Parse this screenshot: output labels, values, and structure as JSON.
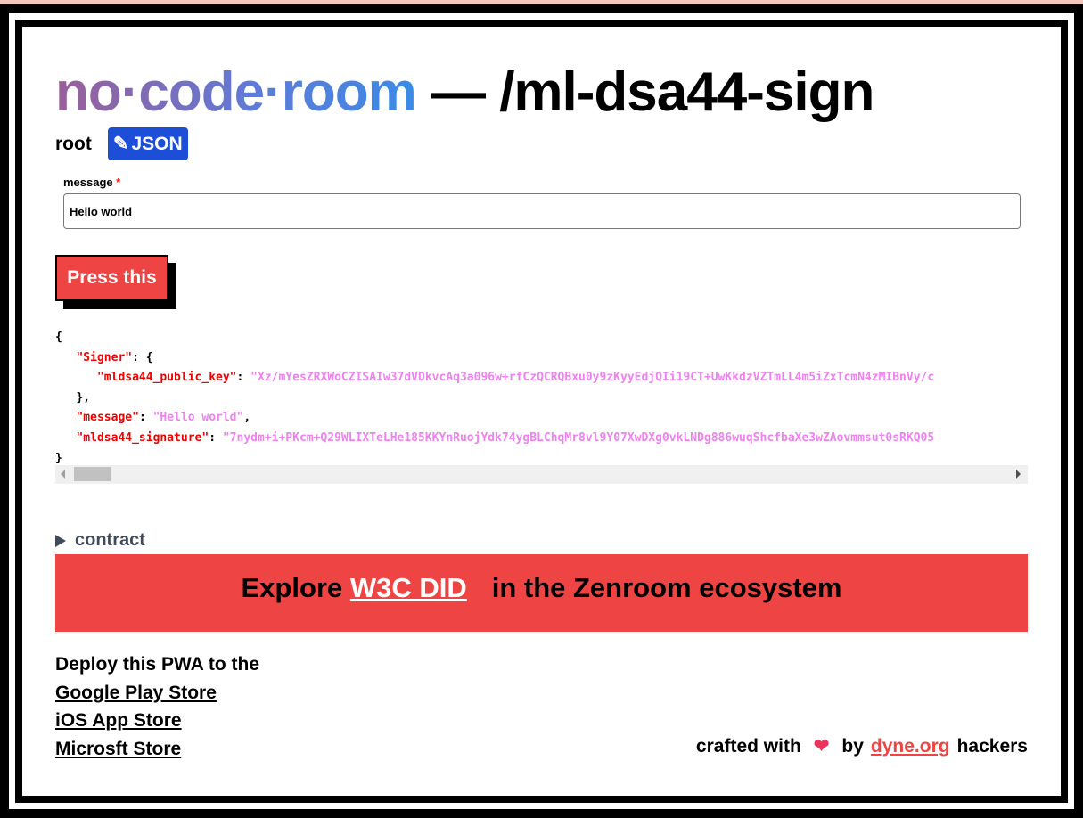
{
  "header": {
    "logo": "no·code·room",
    "title": " — /ml-dsa44-sign"
  },
  "form": {
    "root_label": "root",
    "json_button": "JSON",
    "message_label": "message",
    "required_mark": "*",
    "message_value": "Hello world",
    "submit": "Press this"
  },
  "output": {
    "signer_key": "\"Signer\"",
    "pk_key": "\"mldsa44_public_key\"",
    "pk_value": "\"Xz/mYesZRXWoCZISAIw37dVDkvcAq3a096w+rfCzQCRQBxu0y9zKyyEdjQIi19CT+UwKkdzVZTmLL4m5iZxTcmN4zMIBnVy/c",
    "message_key": "\"message\"",
    "message_value": "\"Hello world\"",
    "sig_key": "\"mldsa44_signature\"",
    "sig_value": "\"7nydm+i+PKcm+Q29WLIXTeLHe185KKYnRuojYdk74ygBLChqMr8vl9Y07XwDXg0vkLNDg886wuqShcfbaXe3wZAovmmsut0sRKQ05"
  },
  "contract": {
    "label": "contract"
  },
  "banner": {
    "prefix": "Explore ",
    "link": "W3C DID",
    "suffix": "in the Zenroom ecosystem"
  },
  "footer": {
    "deploy_text": "Deploy this PWA to the",
    "stores": [
      "Google Play Store",
      "iOS App Store",
      "Microsft Store"
    ],
    "crafted": "crafted with",
    "by": "by",
    "dyne": "dyne.org ",
    "hackers": "hackers"
  },
  "colors": {
    "accent": "#ef4444",
    "json_button": "#1d4ed8",
    "json_key": "#e00000",
    "json_string": "#ee82ee"
  }
}
